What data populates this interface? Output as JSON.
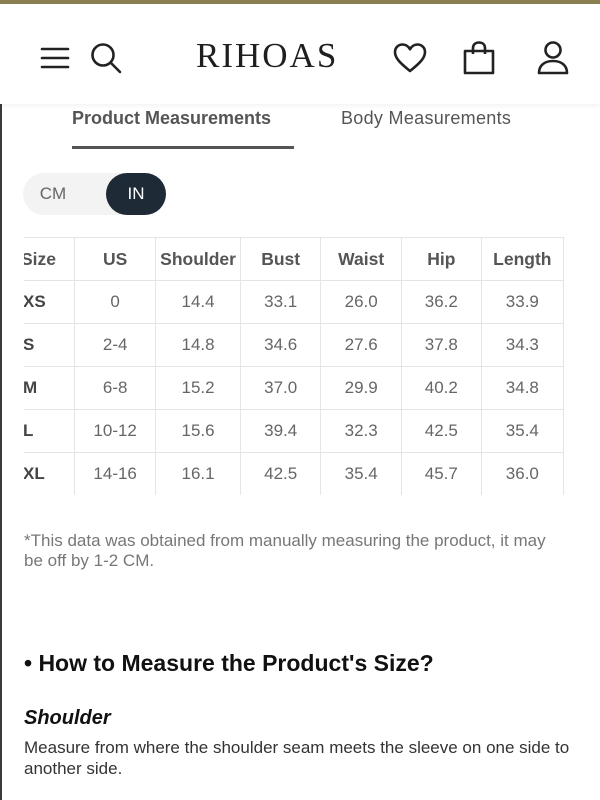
{
  "header": {
    "logo": "RIHOAS",
    "icons": [
      "menu-icon",
      "search-icon",
      "heart-icon",
      "bag-icon",
      "account-icon"
    ]
  },
  "tabs": {
    "product": "Product Measurements",
    "body": "Body Measurements"
  },
  "units": {
    "cm": "CM",
    "in": "IN",
    "selected": "IN"
  },
  "table": {
    "headers": [
      "Size",
      "US",
      "Shoulder",
      "Bust",
      "Waist",
      "Hip",
      "Length"
    ],
    "rows": [
      [
        "XS",
        "0",
        "14.4",
        "33.1",
        "26.0",
        "36.2",
        "33.9"
      ],
      [
        "S",
        "2-4",
        "14.8",
        "34.6",
        "27.6",
        "37.8",
        "34.3"
      ],
      [
        "M",
        "6-8",
        "15.2",
        "37.0",
        "29.9",
        "40.2",
        "34.8"
      ],
      [
        "L",
        "10-12",
        "15.6",
        "39.4",
        "32.3",
        "42.5",
        "35.4"
      ],
      [
        "XL",
        "14-16",
        "16.1",
        "42.5",
        "35.4",
        "45.7",
        "36.0"
      ]
    ]
  },
  "note": "*This data was obtained from manually measuring the product, it may be off by 1-2 CM.",
  "section": {
    "title": "• How to Measure the Product's Size?",
    "shoulder_title": "Shoulder",
    "shoulder_desc": "Measure from where the shoulder seam meets the sleeve on one side to another side."
  }
}
